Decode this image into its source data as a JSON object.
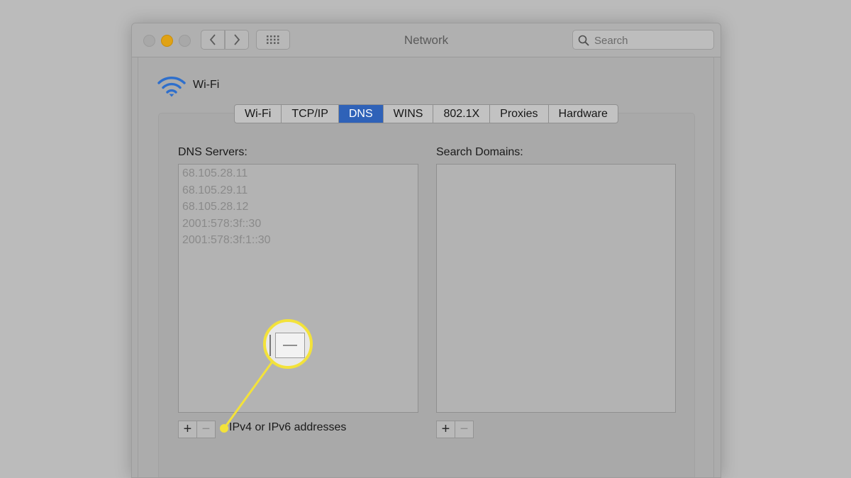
{
  "window": {
    "title": "Network",
    "search_placeholder": "Search"
  },
  "service": {
    "name": "Wi-Fi",
    "icon": "wifi-icon"
  },
  "tabs": [
    {
      "label": "Wi-Fi",
      "active": false
    },
    {
      "label": "TCP/IP",
      "active": false
    },
    {
      "label": "DNS",
      "active": true
    },
    {
      "label": "WINS",
      "active": false
    },
    {
      "label": "802.1X",
      "active": false
    },
    {
      "label": "Proxies",
      "active": false
    },
    {
      "label": "Hardware",
      "active": false
    }
  ],
  "dns": {
    "label": "DNS Servers:",
    "servers": [
      "68.105.28.11",
      "68.105.29.11",
      "68.105.28.12",
      "2001:578:3f::30",
      "2001:578:3f:1::30"
    ],
    "hint": "IPv4 or IPv6 addresses",
    "add_label": "+",
    "remove_label": "−"
  },
  "domains": {
    "label": "Search Domains:",
    "add_label": "+",
    "remove_label": "−"
  },
  "colors": {
    "accent": "#2f62b8",
    "highlight": "#f3e23a",
    "minimize": "#e0a214"
  }
}
